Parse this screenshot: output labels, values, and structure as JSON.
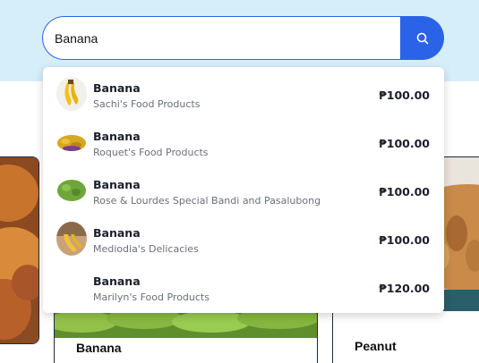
{
  "search": {
    "value": "Banana",
    "button_icon": "search-icon"
  },
  "results": [
    {
      "name": "Banana",
      "store": "Sachi's Food Products",
      "price": "₱100.00",
      "thumb": "banana-bunch"
    },
    {
      "name": "Banana",
      "store": "Roquet's Food Products",
      "price": "₱100.00",
      "thumb": "banana-chips"
    },
    {
      "name": "Banana",
      "store": "Rose & Lourdes Special Bandi and Pasalubong",
      "price": "₱100.00",
      "thumb": "green-bananas"
    },
    {
      "name": "Banana",
      "store": "Mediodia's Delicacies",
      "price": "₱100.00",
      "thumb": "banana-photo"
    },
    {
      "name": "Banana",
      "store": "Marilyn's Food Products",
      "price": "₱120.00",
      "thumb": "none"
    }
  ],
  "cards": {
    "middle_title": "Banana",
    "right_title": "Peanut"
  },
  "colors": {
    "accent": "#2b63e8",
    "top_band": "#d6eef9"
  }
}
